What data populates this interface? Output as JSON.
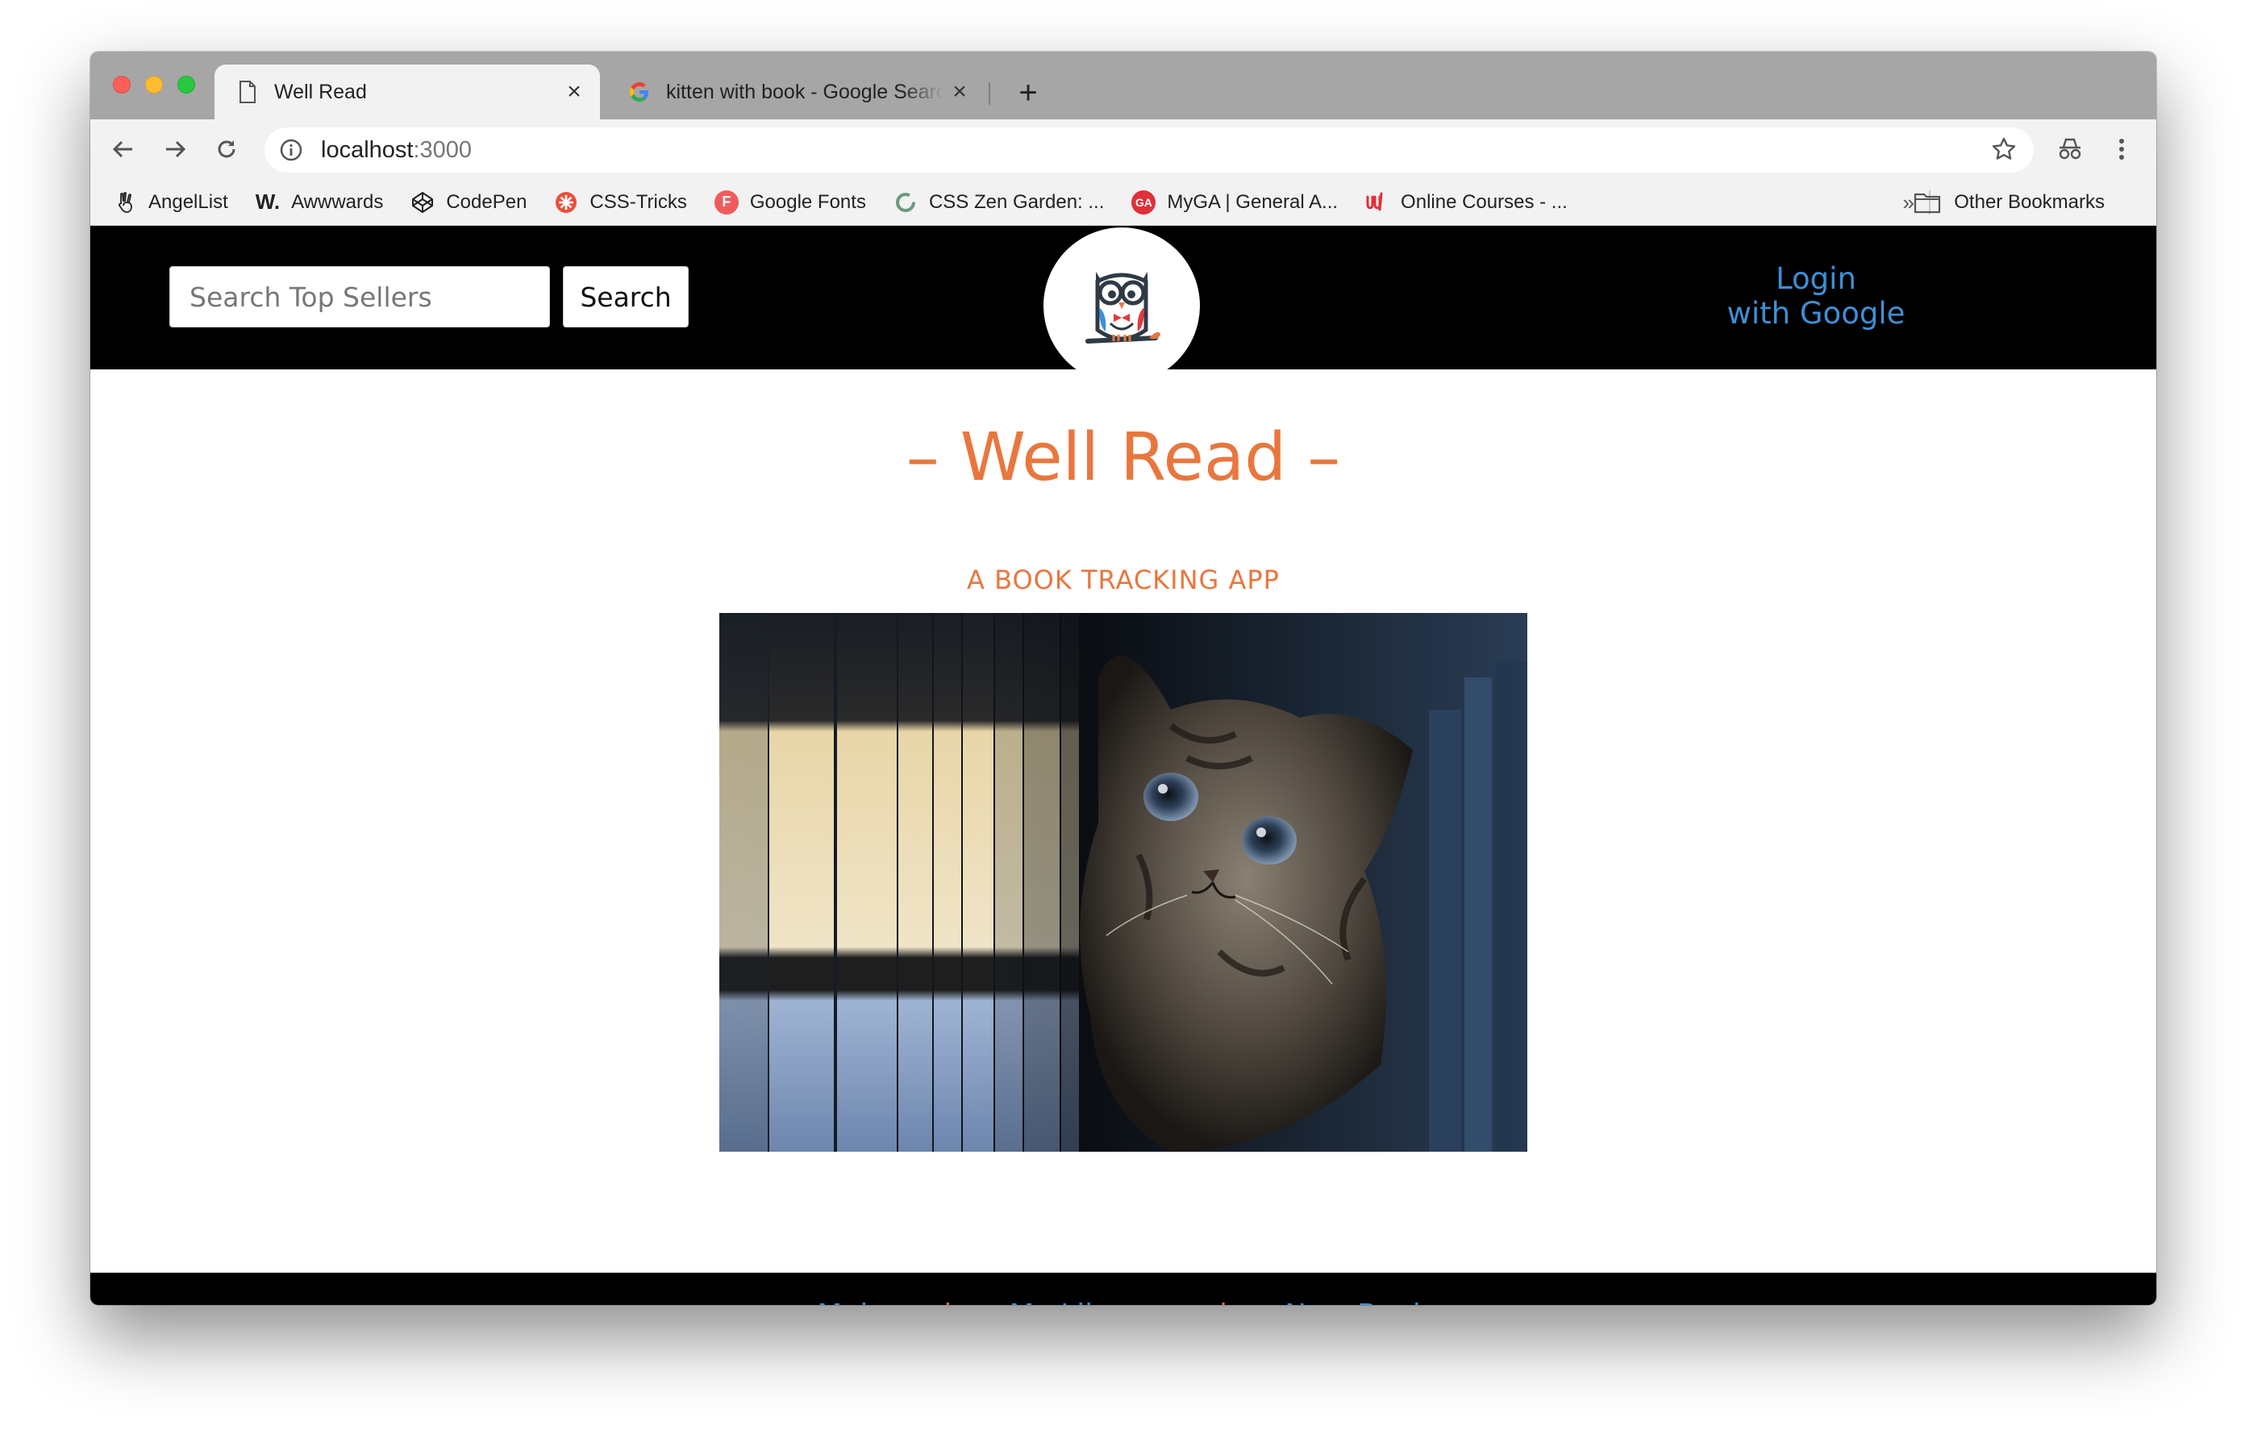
{
  "browser": {
    "tabs": [
      {
        "title": "Well Read",
        "icon": "document-icon"
      },
      {
        "title": "kitten with book - Google Search",
        "icon": "google-icon"
      }
    ],
    "close_glyph": "×",
    "new_tab_glyph": "+",
    "url_host": "localhost",
    "url_port": ":3000",
    "bookmarks": [
      {
        "label": "AngelList",
        "icon": "angellist-icon"
      },
      {
        "label": "Awwwards",
        "icon": "awwwards-icon",
        "icon_text": "W."
      },
      {
        "label": "CodePen",
        "icon": "codepen-icon"
      },
      {
        "label": "CSS-Tricks",
        "icon": "css-tricks-icon"
      },
      {
        "label": "Google Fonts",
        "icon": "google-fonts-icon",
        "icon_text": "F"
      },
      {
        "label": "CSS Zen Garden: ...",
        "icon": "zen-garden-icon"
      },
      {
        "label": "MyGA | General A...",
        "icon": "ga-icon",
        "icon_text": "GA"
      },
      {
        "label": "Online Courses - ...",
        "icon": "udemy-icon"
      }
    ],
    "overflow_glyph": "»",
    "other_bookmarks": "Other Bookmarks"
  },
  "site": {
    "search_placeholder": "Search Top Sellers",
    "search_button": "Search",
    "login_line1": "Login",
    "login_line2": "with Google",
    "title": "– Well Read –",
    "subtitle": "A BOOK TRACKING APP",
    "footer": {
      "links": [
        "Main",
        "My Library",
        "New Book"
      ],
      "separator": "|"
    }
  },
  "colors": {
    "accent_orange": "#e8773e",
    "link_blue": "#3d8fd6",
    "header_bg": "#000000"
  }
}
